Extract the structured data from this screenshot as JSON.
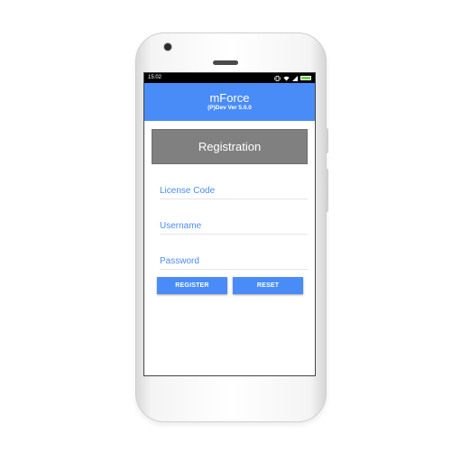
{
  "status_bar": {
    "time": "15:02",
    "battery_level": 1.0,
    "icons": [
      "vibrate-icon",
      "wifi-icon",
      "signal-icon",
      "battery-icon"
    ]
  },
  "app_bar": {
    "title": "mForce",
    "subtitle": "(P)Dev Ver 5.0.0"
  },
  "registration": {
    "header": "Registration",
    "fields": [
      {
        "name": "license-code",
        "value": "",
        "placeholder": "License Code"
      },
      {
        "name": "username",
        "value": "",
        "placeholder": "Username"
      },
      {
        "name": "password",
        "value": "",
        "placeholder": "Password"
      }
    ],
    "register_label": "REGISTER",
    "reset_label": "RESET"
  },
  "colors": {
    "accent": "#4a8cf7",
    "header_gray": "#808080",
    "status_bar": "#000000"
  }
}
